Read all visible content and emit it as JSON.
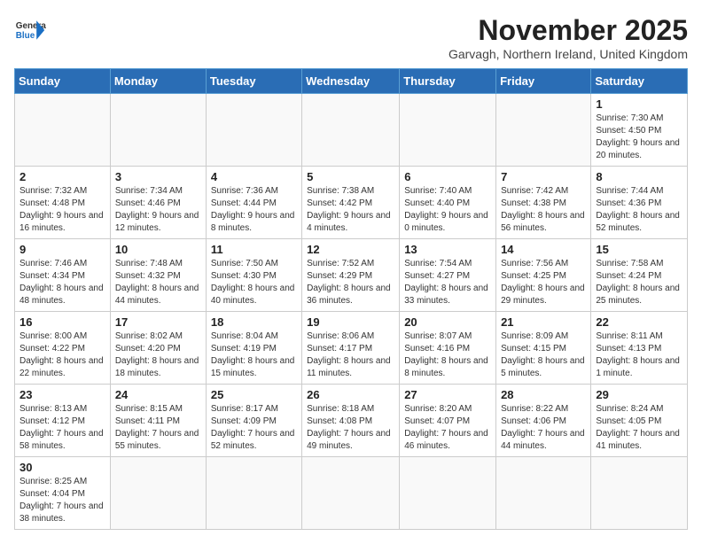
{
  "header": {
    "logo_general": "General",
    "logo_blue": "Blue",
    "month_title": "November 2025",
    "subtitle": "Garvagh, Northern Ireland, United Kingdom"
  },
  "weekdays": [
    "Sunday",
    "Monday",
    "Tuesday",
    "Wednesday",
    "Thursday",
    "Friday",
    "Saturday"
  ],
  "weeks": [
    [
      {
        "day": "",
        "info": ""
      },
      {
        "day": "",
        "info": ""
      },
      {
        "day": "",
        "info": ""
      },
      {
        "day": "",
        "info": ""
      },
      {
        "day": "",
        "info": ""
      },
      {
        "day": "",
        "info": ""
      },
      {
        "day": "1",
        "info": "Sunrise: 7:30 AM\nSunset: 4:50 PM\nDaylight: 9 hours and 20 minutes."
      }
    ],
    [
      {
        "day": "2",
        "info": "Sunrise: 7:32 AM\nSunset: 4:48 PM\nDaylight: 9 hours and 16 minutes."
      },
      {
        "day": "3",
        "info": "Sunrise: 7:34 AM\nSunset: 4:46 PM\nDaylight: 9 hours and 12 minutes."
      },
      {
        "day": "4",
        "info": "Sunrise: 7:36 AM\nSunset: 4:44 PM\nDaylight: 9 hours and 8 minutes."
      },
      {
        "day": "5",
        "info": "Sunrise: 7:38 AM\nSunset: 4:42 PM\nDaylight: 9 hours and 4 minutes."
      },
      {
        "day": "6",
        "info": "Sunrise: 7:40 AM\nSunset: 4:40 PM\nDaylight: 9 hours and 0 minutes."
      },
      {
        "day": "7",
        "info": "Sunrise: 7:42 AM\nSunset: 4:38 PM\nDaylight: 8 hours and 56 minutes."
      },
      {
        "day": "8",
        "info": "Sunrise: 7:44 AM\nSunset: 4:36 PM\nDaylight: 8 hours and 52 minutes."
      }
    ],
    [
      {
        "day": "9",
        "info": "Sunrise: 7:46 AM\nSunset: 4:34 PM\nDaylight: 8 hours and 48 minutes."
      },
      {
        "day": "10",
        "info": "Sunrise: 7:48 AM\nSunset: 4:32 PM\nDaylight: 8 hours and 44 minutes."
      },
      {
        "day": "11",
        "info": "Sunrise: 7:50 AM\nSunset: 4:30 PM\nDaylight: 8 hours and 40 minutes."
      },
      {
        "day": "12",
        "info": "Sunrise: 7:52 AM\nSunset: 4:29 PM\nDaylight: 8 hours and 36 minutes."
      },
      {
        "day": "13",
        "info": "Sunrise: 7:54 AM\nSunset: 4:27 PM\nDaylight: 8 hours and 33 minutes."
      },
      {
        "day": "14",
        "info": "Sunrise: 7:56 AM\nSunset: 4:25 PM\nDaylight: 8 hours and 29 minutes."
      },
      {
        "day": "15",
        "info": "Sunrise: 7:58 AM\nSunset: 4:24 PM\nDaylight: 8 hours and 25 minutes."
      }
    ],
    [
      {
        "day": "16",
        "info": "Sunrise: 8:00 AM\nSunset: 4:22 PM\nDaylight: 8 hours and 22 minutes."
      },
      {
        "day": "17",
        "info": "Sunrise: 8:02 AM\nSunset: 4:20 PM\nDaylight: 8 hours and 18 minutes."
      },
      {
        "day": "18",
        "info": "Sunrise: 8:04 AM\nSunset: 4:19 PM\nDaylight: 8 hours and 15 minutes."
      },
      {
        "day": "19",
        "info": "Sunrise: 8:06 AM\nSunset: 4:17 PM\nDaylight: 8 hours and 11 minutes."
      },
      {
        "day": "20",
        "info": "Sunrise: 8:07 AM\nSunset: 4:16 PM\nDaylight: 8 hours and 8 minutes."
      },
      {
        "day": "21",
        "info": "Sunrise: 8:09 AM\nSunset: 4:15 PM\nDaylight: 8 hours and 5 minutes."
      },
      {
        "day": "22",
        "info": "Sunrise: 8:11 AM\nSunset: 4:13 PM\nDaylight: 8 hours and 1 minute."
      }
    ],
    [
      {
        "day": "23",
        "info": "Sunrise: 8:13 AM\nSunset: 4:12 PM\nDaylight: 7 hours and 58 minutes."
      },
      {
        "day": "24",
        "info": "Sunrise: 8:15 AM\nSunset: 4:11 PM\nDaylight: 7 hours and 55 minutes."
      },
      {
        "day": "25",
        "info": "Sunrise: 8:17 AM\nSunset: 4:09 PM\nDaylight: 7 hours and 52 minutes."
      },
      {
        "day": "26",
        "info": "Sunrise: 8:18 AM\nSunset: 4:08 PM\nDaylight: 7 hours and 49 minutes."
      },
      {
        "day": "27",
        "info": "Sunrise: 8:20 AM\nSunset: 4:07 PM\nDaylight: 7 hours and 46 minutes."
      },
      {
        "day": "28",
        "info": "Sunrise: 8:22 AM\nSunset: 4:06 PM\nDaylight: 7 hours and 44 minutes."
      },
      {
        "day": "29",
        "info": "Sunrise: 8:24 AM\nSunset: 4:05 PM\nDaylight: 7 hours and 41 minutes."
      }
    ],
    [
      {
        "day": "30",
        "info": "Sunrise: 8:25 AM\nSunset: 4:04 PM\nDaylight: 7 hours and 38 minutes."
      },
      {
        "day": "",
        "info": ""
      },
      {
        "day": "",
        "info": ""
      },
      {
        "day": "",
        "info": ""
      },
      {
        "day": "",
        "info": ""
      },
      {
        "day": "",
        "info": ""
      },
      {
        "day": "",
        "info": ""
      }
    ]
  ]
}
